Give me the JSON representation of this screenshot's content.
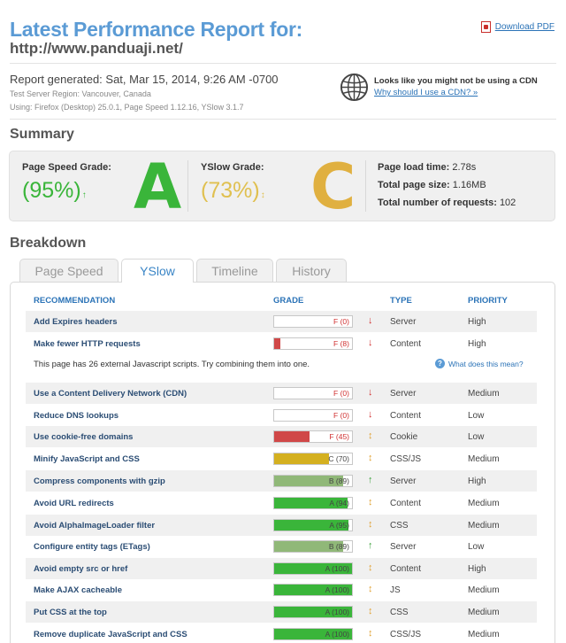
{
  "header": {
    "title": "Latest Performance Report for:",
    "url": "http://www.panduaji.net/",
    "download_label": "Download PDF"
  },
  "report": {
    "generated": "Report generated: Sat, Mar 15, 2014, 9:26 AM -0700",
    "region": "Test Server Region: Vancouver, Canada",
    "using": "Using: Firefox (Desktop) 25.0.1, Page Speed 1.12.16, YSlow 3.1.7"
  },
  "cdn": {
    "message": "Looks like you might not be using a CDN",
    "link": "Why should I use a CDN? »"
  },
  "summary": {
    "heading": "Summary",
    "pagespeed": {
      "label": "Page Speed Grade:",
      "percent": "(95%)",
      "letter": "A",
      "arrow": "↑",
      "color": "#3ab53a"
    },
    "yslow": {
      "label": "YSlow Grade:",
      "percent": "(73%)",
      "letter": "C",
      "arrow": "↕",
      "color": "#e0b040"
    },
    "stats": [
      {
        "label": "Page load time:",
        "value": "2.78s"
      },
      {
        "label": "Total page size:",
        "value": "1.16MB"
      },
      {
        "label": "Total number of requests:",
        "value": "102"
      }
    ]
  },
  "breakdown": {
    "heading": "Breakdown",
    "tabs": [
      "Page Speed",
      "YSlow",
      "Timeline",
      "History"
    ],
    "active_tab": 1,
    "columns": [
      "RECOMMENDATION",
      "GRADE",
      "TYPE",
      "PRIORITY"
    ],
    "note": "This page has 26 external Javascript scripts. Try combining them into one.",
    "help": "What does this mean?",
    "rows": [
      {
        "name": "Add Expires headers",
        "grade": "F (0)",
        "score": 0,
        "type": "Server",
        "priority": "High",
        "arrow": "↓"
      },
      {
        "name": "Make fewer HTTP requests",
        "grade": "F (8)",
        "score": 8,
        "type": "Content",
        "priority": "High",
        "arrow": "↓"
      },
      {
        "name": "Use a Content Delivery Network (CDN)",
        "grade": "F (0)",
        "score": 0,
        "type": "Server",
        "priority": "Medium",
        "arrow": "↓"
      },
      {
        "name": "Reduce DNS lookups",
        "grade": "F (0)",
        "score": 0,
        "type": "Content",
        "priority": "Low",
        "arrow": "↓"
      },
      {
        "name": "Use cookie-free domains",
        "grade": "F (45)",
        "score": 45,
        "type": "Cookie",
        "priority": "Low",
        "arrow": "↕"
      },
      {
        "name": "Minify JavaScript and CSS",
        "grade": "C (70)",
        "score": 70,
        "type": "CSS/JS",
        "priority": "Medium",
        "arrow": "↕"
      },
      {
        "name": "Compress components with gzip",
        "grade": "B (89)",
        "score": 89,
        "type": "Server",
        "priority": "High",
        "arrow": "↑"
      },
      {
        "name": "Avoid URL redirects",
        "grade": "A (94)",
        "score": 94,
        "type": "Content",
        "priority": "Medium",
        "arrow": "↕"
      },
      {
        "name": "Avoid AlphaImageLoader filter",
        "grade": "A (95)",
        "score": 95,
        "type": "CSS",
        "priority": "Medium",
        "arrow": "↕"
      },
      {
        "name": "Configure entity tags (ETags)",
        "grade": "B (89)",
        "score": 89,
        "type": "Server",
        "priority": "Low",
        "arrow": "↑"
      },
      {
        "name": "Avoid empty src or href",
        "grade": "A (100)",
        "score": 100,
        "type": "Content",
        "priority": "High",
        "arrow": "↕"
      },
      {
        "name": "Make AJAX cacheable",
        "grade": "A (100)",
        "score": 100,
        "type": "JS",
        "priority": "Medium",
        "arrow": "↕"
      },
      {
        "name": "Put CSS at the top",
        "grade": "A (100)",
        "score": 100,
        "type": "CSS",
        "priority": "Medium",
        "arrow": "↕"
      },
      {
        "name": "Remove duplicate JavaScript and CSS",
        "grade": "A (100)",
        "score": 100,
        "type": "CSS/JS",
        "priority": "Medium",
        "arrow": "↕"
      }
    ]
  },
  "colors": {
    "link": "#2b73b7",
    "grade_a": "#3ab53a",
    "grade_b": "#90b878",
    "grade_c": "#d4b020",
    "grade_f": "#d04848",
    "arrow_down": "#d03030",
    "arrow_up": "#3aa03a",
    "arrow_flat": "#e0a030"
  }
}
